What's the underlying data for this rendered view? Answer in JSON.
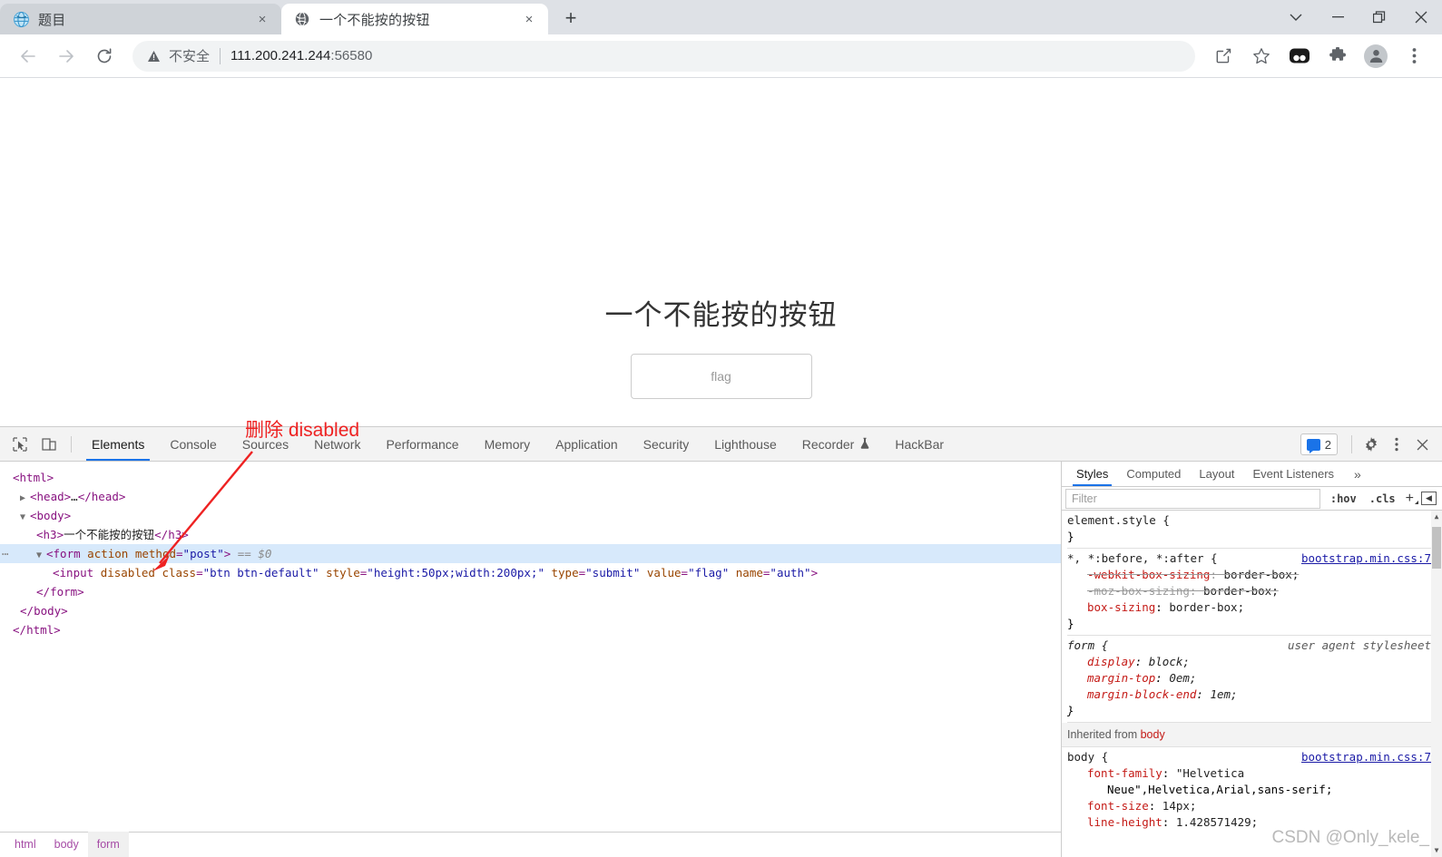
{
  "browser": {
    "tabs": [
      {
        "title": "题目",
        "favicon": "globe-blue-icon",
        "active": false,
        "close_label": "×"
      },
      {
        "title": "一个不能按的按钮",
        "favicon": "globe-dark-icon",
        "active": true,
        "close_label": "×"
      }
    ],
    "new_tab_label": "+",
    "window_controls": {
      "list_label": "⌄",
      "minimize_label": "—",
      "maximize_label": "❐",
      "close_label": "✕"
    },
    "toolbar": {
      "back_label": "←",
      "forward_label": "→",
      "reload_label": "⟳",
      "security_warning": "不安全",
      "url": "111.200.241.244",
      "port": ":56580",
      "share_icon": "share-icon",
      "bookmark_icon": "star-icon",
      "extension_icon": "puzzle-icon",
      "profile_icon": "profile-avatar-icon",
      "menu_icon": "kebab-menu-icon"
    }
  },
  "page": {
    "heading": "一个不能按的按钮",
    "button_label": "flag"
  },
  "devtools": {
    "left_icons": [
      {
        "name": "inspect-element-icon"
      },
      {
        "name": "device-toolbar-icon"
      }
    ],
    "tabs": [
      {
        "label": "Elements",
        "active": true
      },
      {
        "label": "Console",
        "active": false
      },
      {
        "label": "Sources",
        "active": false
      },
      {
        "label": "Network",
        "active": false
      },
      {
        "label": "Performance",
        "active": false
      },
      {
        "label": "Memory",
        "active": false
      },
      {
        "label": "Application",
        "active": false
      },
      {
        "label": "Security",
        "active": false
      },
      {
        "label": "Lighthouse",
        "active": false
      },
      {
        "label": "Recorder",
        "active": false,
        "suffix_icon": "beaker-icon",
        "suffix": "⚗"
      },
      {
        "label": "HackBar",
        "active": false
      }
    ],
    "message_count": "2",
    "settings_icon": "gear-icon",
    "more_icon": "kebab-menu-icon",
    "close_icon": "close-icon",
    "dom": {
      "lines": [
        "<html>",
        "<head>…</head>",
        "<body>",
        "<h3>一个不能按的按钮</h3>",
        "<form action method=\"post\"> == $0",
        "<input disabled class=\"btn btn-default\" style=\"height:50px;width:200px;\" type=\"submit\" value=\"flag\" name=\"auth\">",
        "</form>",
        "</body>",
        "</html>"
      ],
      "h3_text": "一个不能按的按钮",
      "form_attrs": {
        "action": "action",
        "method_name": "method",
        "method_value": "post"
      },
      "form_marker": "== $0",
      "input_attrs": {
        "disabled": "disabled",
        "class_name": "class",
        "class_value": "btn btn-default",
        "style_name": "style",
        "style_value": "height:50px;width:200px;",
        "type_name": "type",
        "type_value": "submit",
        "value_name": "value",
        "value_value": "flag",
        "name_name": "name",
        "name_value": "auth"
      }
    },
    "breadcrumbs": [
      {
        "label": "html",
        "active": false
      },
      {
        "label": "body",
        "active": false
      },
      {
        "label": "form",
        "active": true
      }
    ],
    "styles": {
      "tabs": [
        {
          "label": "Styles",
          "active": true
        },
        {
          "label": "Computed",
          "active": false
        },
        {
          "label": "Layout",
          "active": false
        },
        {
          "label": "Event Listeners",
          "active": false
        }
      ],
      "more_label": "»",
      "filter_placeholder": "Filter",
      "hov_label": ":hov",
      "cls_label": ".cls",
      "plus_label": "+",
      "sidebar_toggle_icon": "toggle-sidebar-icon",
      "rules": [
        {
          "selector": "element.style {",
          "origin": "",
          "close": "}",
          "declarations": []
        },
        {
          "selector": "*, *:before, *:after {",
          "origin": "bootstrap.min.css:7",
          "origin_is_link": true,
          "close": "}",
          "declarations": [
            {
              "prop": "-webkit-box-sizing",
              "value": "border-box;",
              "struck": true
            },
            {
              "prop": "-moz-box-sizing",
              "value": "border-box;",
              "struck": true
            },
            {
              "prop": "box-sizing",
              "value": "border-box;",
              "struck": false
            }
          ]
        },
        {
          "selector": "form {",
          "origin": "user agent stylesheet",
          "origin_is_link": false,
          "close": "}",
          "italic": true,
          "declarations": [
            {
              "prop": "display",
              "value": "block;",
              "struck": false
            },
            {
              "prop": "margin-top",
              "value": "0em;",
              "struck": false
            },
            {
              "prop": "margin-block-end",
              "value": "1em;",
              "struck": false
            }
          ]
        }
      ],
      "inherited_header_text": "Inherited from",
      "inherited_header_node": "body",
      "inherited_rule": {
        "selector": "body {",
        "origin": "bootstrap.min.css:7",
        "declarations": [
          {
            "prop": "font-family",
            "value": "\"Helvetica"
          },
          {
            "prop": "",
            "value": "Neue\",Helvetica,Arial,sans-serif;"
          },
          {
            "prop": "font-size",
            "value": "14px;"
          },
          {
            "prop": "line-height",
            "value": "1.428571429;"
          }
        ]
      }
    }
  },
  "annotation": {
    "text": "删除 disabled",
    "color": "#ee2222"
  },
  "watermark": "CSDN @Only_kele_"
}
